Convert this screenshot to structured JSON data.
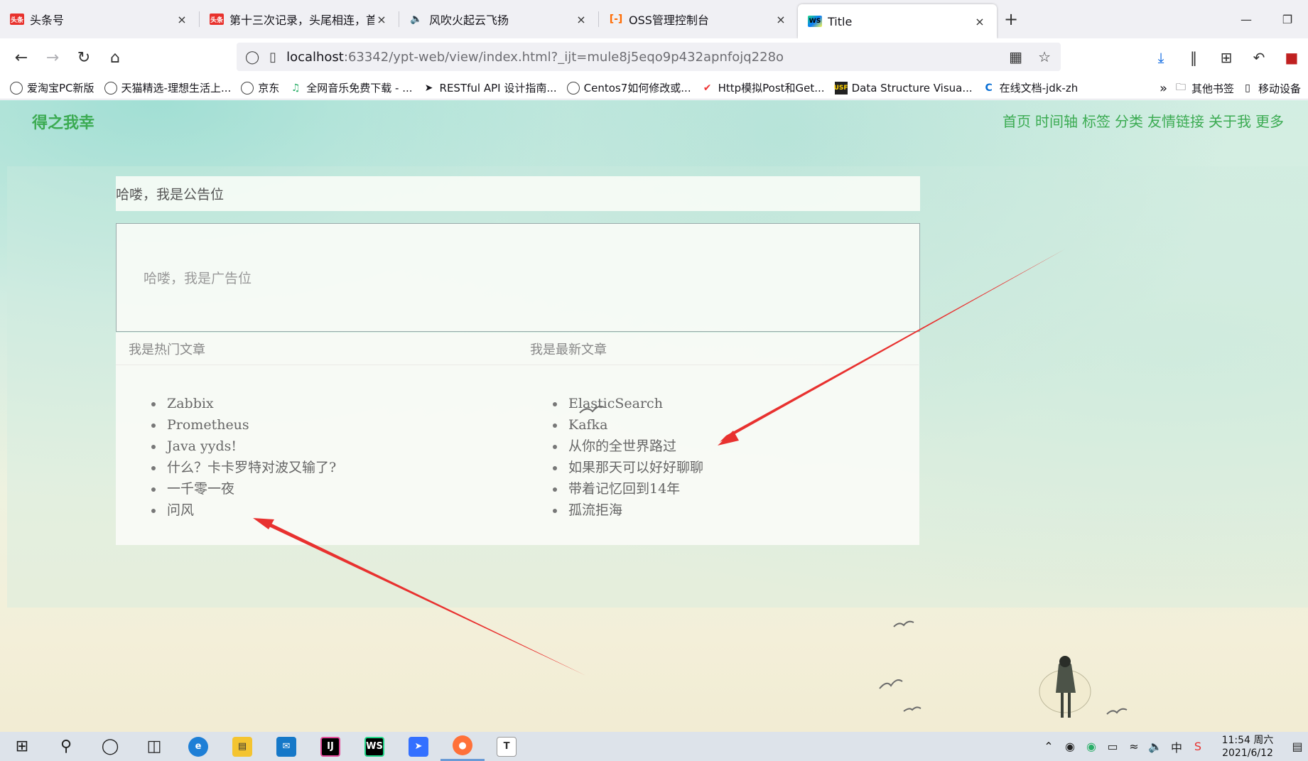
{
  "browser": {
    "tabs": [
      {
        "label": "头条号",
        "icon": "toutiao-icon",
        "favicon_text": "头条"
      },
      {
        "label": "第十三次记录，头尾相连，首页",
        "icon": "toutiao-icon",
        "favicon_text": "头条"
      },
      {
        "label": "风吹火起云飞扬",
        "icon": "speaker-icon",
        "favicon_text": "🔈"
      },
      {
        "label": "OSS管理控制台",
        "icon": "alicloud-icon",
        "favicon_text": "[-]"
      },
      {
        "label": "Title",
        "icon": "webstorm-icon",
        "favicon_text": "WS",
        "active": true
      }
    ],
    "close_glyph": "×",
    "new_tab_glyph": "+",
    "url_host": "localhost",
    "url_rest": ":63342/ypt-web/view/index.html?_ijt=mule8j5eqo9p432apnfojq228o",
    "bookmarks": [
      {
        "label": "爱淘宝PC新版",
        "icon": "globe-icon"
      },
      {
        "label": "天猫精选-理想生活上...",
        "icon": "globe-icon"
      },
      {
        "label": "京东",
        "icon": "globe-icon"
      },
      {
        "label": "全网音乐免费下载 - ...",
        "icon": "music-icon"
      },
      {
        "label": "RESTful API 设计指南...",
        "icon": "restful-icon"
      },
      {
        "label": "Centos7如何修改或...",
        "icon": "globe-icon"
      },
      {
        "label": "Http模拟Post和Get...",
        "icon": "check-icon"
      },
      {
        "label": "Data Structure Visua...",
        "icon": "usf-icon"
      },
      {
        "label": "在线文档-jdk-zh",
        "icon": "edge-icon"
      }
    ],
    "bookmarks_right": [
      {
        "label": "其他书签",
        "icon": "folder-icon"
      },
      {
        "label": "移动设备",
        "icon": "mobile-icon"
      }
    ]
  },
  "site": {
    "title": "得之我幸",
    "nav": [
      "首页",
      "时间轴",
      "标签",
      "分类",
      "友情链接",
      "关于我",
      "更多"
    ],
    "notice": "哈喽，我是公告位",
    "ad": "哈喽，我是广告位",
    "hot": {
      "heading": "我是热门文章",
      "items": [
        "Zabbix",
        "Prometheus",
        "Java yyds!",
        "什么？卡卡罗特对波又输了?",
        "一千零一夜",
        "问风"
      ]
    },
    "latest": {
      "heading": "我是最新文章",
      "items": [
        "ElasticSearch",
        "Kafka",
        "从你的全世界路过",
        "如果那天可以好好聊聊",
        "带着记忆回到14年",
        "孤流拒海"
      ]
    },
    "accent_color": "#3bab52",
    "annotation_color": "#e8312f"
  },
  "taskbar": {
    "time": "11:54 周六",
    "date": "2021/6/12",
    "ime": "中"
  }
}
